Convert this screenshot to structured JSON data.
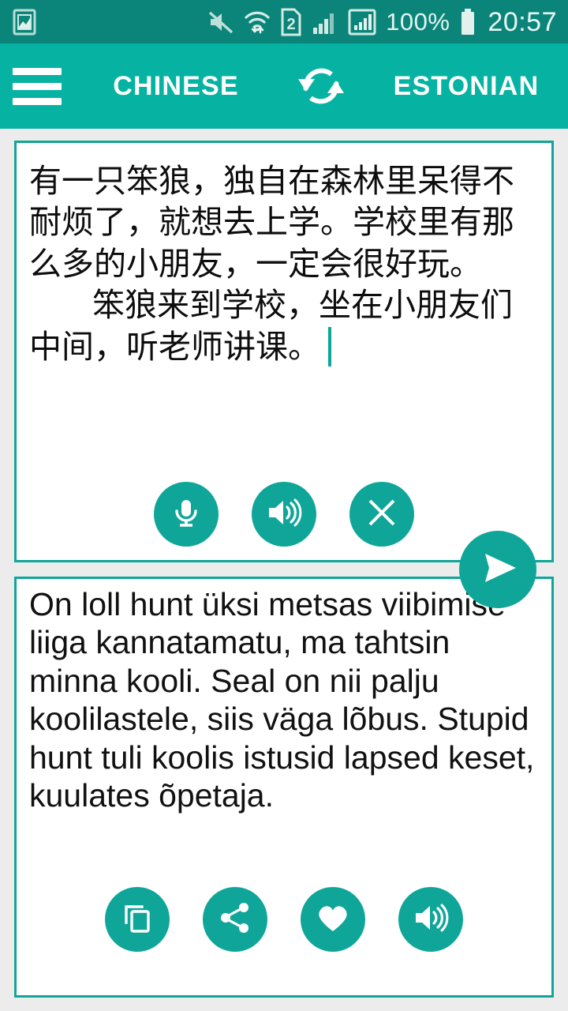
{
  "status_bar": {
    "left_icon": "photo-icon",
    "icons": [
      "mute-icon",
      "wifi-icon",
      "sim-2-icon",
      "signal-bars-icon",
      "signal-boxed-icon"
    ],
    "sim_label": "2",
    "battery_percent": "100%",
    "battery_icon": "battery-full-icon",
    "clock": "20:57",
    "background_color": "#0b8579"
  },
  "header": {
    "menu_icon": "hamburger-menu-icon",
    "source_language": "CHINESE",
    "swap_icon": "swap-languages-icon",
    "target_language": "ESTONIAN",
    "background_color": "#06b3a2"
  },
  "source_card": {
    "text_line_1": "有一只笨狼，独自在森林里呆得不耐烦了，就想去上学。学校里有那么多的小朋友，一定会很好玩。",
    "text_line_2": "笨狼来到学校，坐在小朋友们中间，听老师讲课。",
    "cursor_visible": true,
    "buttons": [
      {
        "name": "microphone-button",
        "icon": "microphone-icon"
      },
      {
        "name": "speak-source-button",
        "icon": "speaker-icon"
      },
      {
        "name": "clear-button",
        "icon": "close-x-icon"
      }
    ],
    "border_color": "#0fa699"
  },
  "send_button": {
    "name": "translate-send-button",
    "icon": "send-paper-plane-icon",
    "color": "#0fa699"
  },
  "target_card": {
    "translation": "On loll hunt üksi metsas viibimise liiga kannatamatu, ma tahtsin minna kooli. Seal on nii palju koolilastele, siis väga lõbus. Stupid hunt tuli koolis istusid lapsed keset, kuulates õpetaja.",
    "buttons": [
      {
        "name": "copy-button",
        "icon": "copy-icon"
      },
      {
        "name": "share-button",
        "icon": "share-icon"
      },
      {
        "name": "favorite-button",
        "icon": "heart-icon"
      },
      {
        "name": "speak-translation-button",
        "icon": "speaker-icon"
      }
    ],
    "border_color": "#0fa699"
  }
}
